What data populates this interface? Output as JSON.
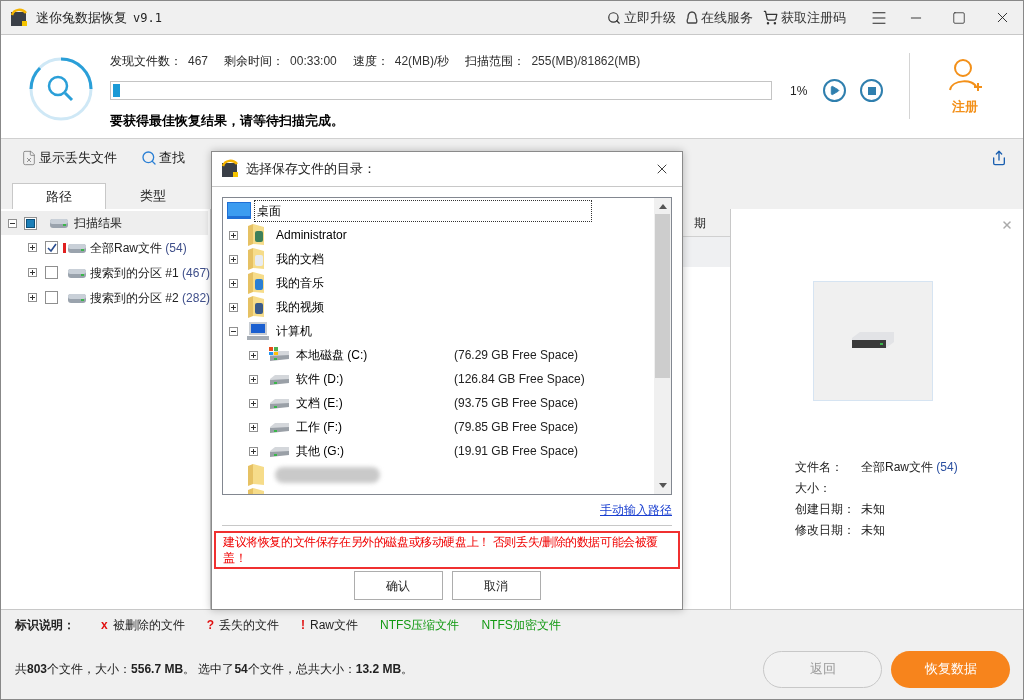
{
  "window": {
    "title": "迷你兔数据恢复",
    "version": "v9.1",
    "actions": [
      {
        "label": "立即升级",
        "kind": "upgrade"
      },
      {
        "label": "在线服务",
        "kind": "service"
      },
      {
        "label": "获取注册码",
        "kind": "cart"
      }
    ]
  },
  "scan": {
    "stats": [
      {
        "label": "发现文件数：",
        "value": "467"
      },
      {
        "label": "剩余时间：",
        "value": "00:33:00"
      },
      {
        "label": "速度：",
        "value": "42(MB)/秒"
      },
      {
        "label": "扫描范围：",
        "value": "255(MB)/81862(MB)"
      }
    ],
    "level": 0.01,
    "percent": "1%",
    "hint": "要获得最佳恢复结果，请等待扫描完成。"
  },
  "register": {
    "label": "注册"
  },
  "toolbar": [
    {
      "label": "显示丢失文件",
      "kind": "lost"
    },
    {
      "label": "查找",
      "kind": "search"
    }
  ],
  "tabs": [
    {
      "label": "路径",
      "selected": true
    },
    {
      "label": "类型",
      "selected": false
    }
  ],
  "tree": {
    "label": "扫描结果",
    "expanded": true,
    "checked": false,
    "partial": true,
    "children": [
      {
        "label": "全部Raw文件",
        "count": "(54)",
        "kind": "raw",
        "expanded": false,
        "checked": true
      },
      {
        "label": "搜索到的分区 #1",
        "count": "(467)",
        "kind": "partition",
        "expanded": false,
        "checked": false
      },
      {
        "label": "搜索到的分区 #2",
        "count": "(282)",
        "kind": "partition",
        "expanded": false,
        "checked": false
      }
    ]
  },
  "file_list": {
    "column_header": "期"
  },
  "preview": {
    "fields": [
      {
        "label": "文件名：",
        "value": "全部Raw文件",
        "count": "(54)"
      },
      {
        "label": "大小："
      },
      {
        "label": "创建日期：",
        "value": "未知"
      },
      {
        "label": "修改日期：",
        "value": "未知"
      }
    ]
  },
  "legend": {
    "title": "标识说明：",
    "items": [
      {
        "mark": "x",
        "label": "被删除的文件",
        "kind": "deleted"
      },
      {
        "mark": "?",
        "label": "丢失的文件",
        "kind": "lost"
      },
      {
        "mark": "!",
        "label": "Raw文件",
        "kind": "raw"
      },
      {
        "label": "NTFS压缩文件",
        "kind": "compressed"
      },
      {
        "label": "NTFS加密文件",
        "kind": "encrypted"
      }
    ]
  },
  "status": "共**803**个文件，大小：**556.7 MB**。 选中了**54**个文件，总共大小：**13.2 MB**。",
  "buttons": [
    {
      "label": "返回",
      "disabled": true
    },
    {
      "label": "恢复数据",
      "disabled": false
    }
  ],
  "dialog": {
    "title": "选择保存文件的目录：",
    "tree": [
      {
        "label": "桌面",
        "kind": "desktop",
        "focused": true,
        "children": [
          {
            "label": "Administrator",
            "kind": "user",
            "expanded": false
          },
          {
            "label": "我的文档",
            "kind": "docs",
            "expanded": false
          },
          {
            "label": "我的音乐",
            "kind": "music",
            "expanded": false
          },
          {
            "label": "我的视频",
            "kind": "video",
            "expanded": false
          },
          {
            "label": "计算机",
            "kind": "computer",
            "expanded": true,
            "children": [
              {
                "label": "本地磁盘 (C:)",
                "free": "(76.29 GB Free Space)",
                "kind": "system-drive",
                "expanded": false
              },
              {
                "label": "软件 (D:)",
                "free": "(126.84 GB Free Space)",
                "kind": "drive",
                "expanded": false
              },
              {
                "label": "文档 (E:)",
                "free": "(93.75 GB Free Space)",
                "kind": "drive",
                "expanded": false
              },
              {
                "label": "工作 (F:)",
                "free": "(79.85 GB Free Space)",
                "kind": "drive",
                "expanded": false
              },
              {
                "label": "其他 (G:)",
                "free": "(19.91 GB Free Space)",
                "kind": "drive",
                "expanded": false
              }
            ]
          },
          {
            "kind": "blurred-folder"
          },
          {
            "kind": "folder"
          }
        ]
      }
    ],
    "link": "手动输入路径",
    "warning": "建议将恢复的文件保存在另外的磁盘或移动硬盘上！ 否则丢失/删除的数据可能会被覆盖！",
    "buttons": [
      "确认",
      "取消"
    ]
  }
}
